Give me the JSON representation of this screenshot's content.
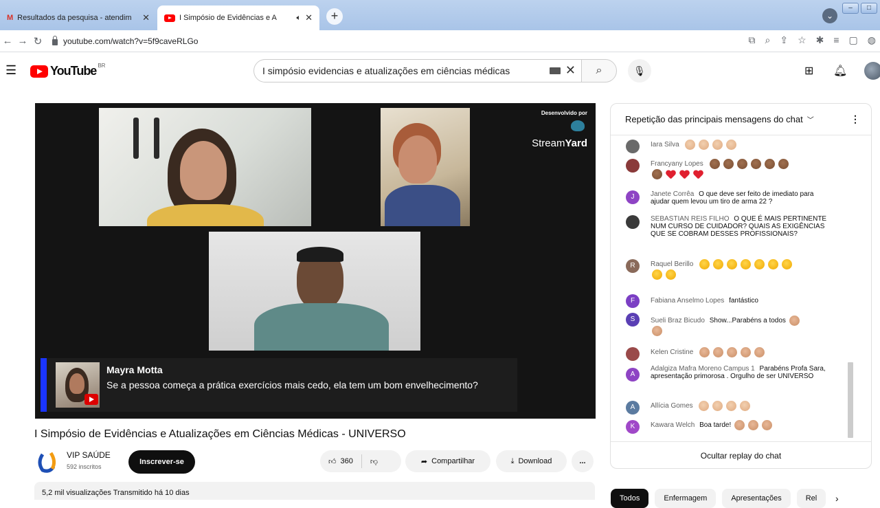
{
  "browser": {
    "tabs": [
      {
        "title": "Resultados da pesquisa - atendim",
        "active": false
      },
      {
        "title": "I Simpósio de Evidências e A",
        "active": true
      }
    ],
    "url": "youtube.com/watch?v=5f9caveRLGo",
    "new_tab_symbol": "+"
  },
  "youtube": {
    "logo_text": "YouTube",
    "country_code": "BR",
    "search_value": "I simpósio evidencias e atualizações em ciências médicas"
  },
  "video": {
    "streamyard_caption": "Desenvolvido por",
    "streamyard_brand_light": "Stream",
    "streamyard_brand_bold": "Yard",
    "banner_name": "Mayra Motta",
    "banner_message": "Se a pessoa começa a prática exercícios mais cedo, ela tem um bom envelhecimento?"
  },
  "info": {
    "title": "I Simpósio de Evidências e Atualizações em Ciências Médicas - UNIVERSO",
    "channel_name": "VIP SAÚDE",
    "subscribers": "592 inscritos",
    "subscribe_label": "Inscrever-se",
    "like_count": "360",
    "share_label": "Compartilhar",
    "download_label": "Download",
    "more_label": "...",
    "views_line": "5,2 mil visualizações  Transmitido há 10 dias"
  },
  "chat": {
    "header": "Repetição das principais mensagens do chat",
    "footer": "Ocultar replay do chat",
    "messages": [
      {
        "author": "Iara Silva",
        "text": ""
      },
      {
        "author": "Francyany Lopes",
        "text": ""
      },
      {
        "author": "Janete Corrêa",
        "text": "O que deve ser feito de imediato para ajudar quem levou um tiro de arma 22 ?"
      },
      {
        "author": "SEBASTIAN REIS FILHO",
        "text": "O QUE É MAIS PERTINENTE NUM CURSO DE CUIDADOR? QUAIS AS EXIGÊNCIAS QUE SE COBRAM DESSES PROFISSIONAIS?"
      },
      {
        "author": "Raquel Berillo",
        "text": ""
      },
      {
        "author": "Fabiana Anselmo Lopes",
        "text": "fantástico"
      },
      {
        "author": "Sueli Braz Bicudo",
        "text": "Show...Parabéns a todos"
      },
      {
        "author": "Kelen Cristine",
        "text": ""
      },
      {
        "author": "Adalgiza Mafra Moreno Campus 1",
        "text": "Parabéns Profa Sara, apresentação primorosa . Orgulho de ser UNIVERSO"
      },
      {
        "author": "Allícia Gomes",
        "text": ""
      },
      {
        "author": "Kawara Welch",
        "text": "Boa tarde!"
      }
    ],
    "avatar_letters": [
      "",
      "",
      "J",
      "",
      "R",
      "F",
      "S",
      "",
      "A",
      "A",
      "K"
    ]
  },
  "chips": [
    "Todos",
    "Enfermagem",
    "Apresentações",
    "Rel"
  ],
  "colors": {
    "youtube_red": "#ff0000",
    "banner_accent": "#1a35ff",
    "chip_active": "#0f0f0f"
  }
}
